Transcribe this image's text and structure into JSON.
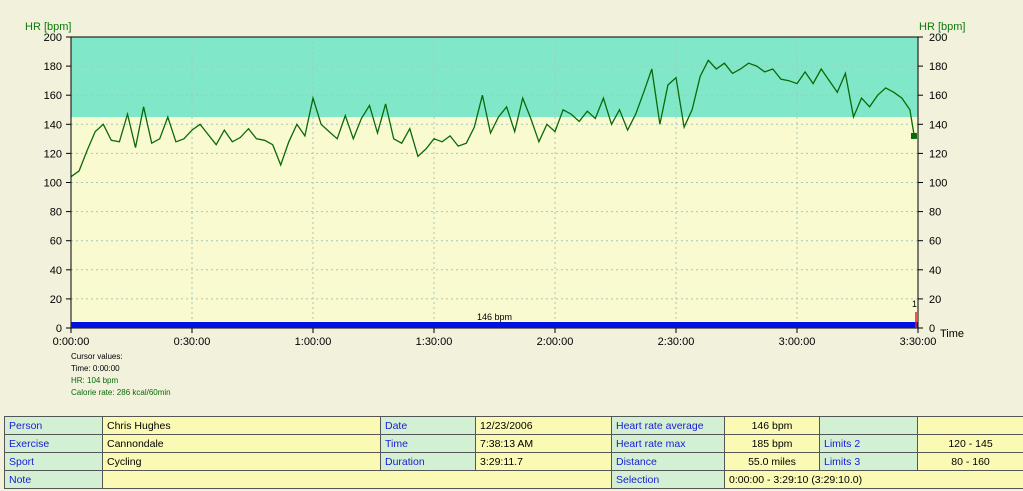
{
  "chart_data": {
    "type": "line",
    "ylabel_left": "HR [bpm]",
    "ylabel_right": "HR [bpm]",
    "xlabel": "Time",
    "ylim": [
      0,
      200
    ],
    "yticks": [
      "0",
      "20",
      "40",
      "60",
      "80",
      "100",
      "120",
      "140",
      "160",
      "180",
      "200"
    ],
    "xlim_minutes": [
      0,
      210
    ],
    "xticks": [
      "0:00:00",
      "0:30:00",
      "1:00:00",
      "1:30:00",
      "2:00:00",
      "2:30:00",
      "3:00:00",
      "3:30:00"
    ],
    "grid": true,
    "upper_zone_from_bpm": 145,
    "colors": {
      "upper_zone": "#80e8c8",
      "lower_zone": "#fafad0",
      "line": "#0a6a0a",
      "average_bar": "#0010e0",
      "marker": "#e02020"
    },
    "series": [
      {
        "name": "HR",
        "x_minutes": [
          0,
          2,
          4,
          6,
          8,
          10,
          12,
          14,
          16,
          18,
          20,
          22,
          24,
          26,
          28,
          30,
          32,
          34,
          36,
          38,
          40,
          42,
          44,
          46,
          48,
          50,
          52,
          54,
          56,
          58,
          60,
          62,
          64,
          66,
          68,
          70,
          72,
          74,
          76,
          78,
          80,
          82,
          84,
          86,
          88,
          90,
          92,
          94,
          96,
          98,
          100,
          102,
          104,
          106,
          108,
          110,
          112,
          114,
          116,
          118,
          120,
          122,
          124,
          126,
          128,
          130,
          132,
          134,
          136,
          138,
          140,
          142,
          144,
          146,
          148,
          150,
          152,
          154,
          156,
          158,
          160,
          162,
          164,
          166,
          168,
          170,
          172,
          174,
          176,
          178,
          180,
          182,
          184,
          186,
          188,
          190,
          192,
          194,
          196,
          198,
          200,
          202,
          204,
          206,
          208,
          209
        ],
        "values_bpm": [
          104,
          108,
          122,
          135,
          140,
          129,
          128,
          147,
          124,
          152,
          127,
          130,
          145,
          128,
          130,
          136,
          140,
          133,
          126,
          136,
          128,
          131,
          137,
          130,
          129,
          126,
          112,
          128,
          140,
          132,
          158,
          140,
          135,
          130,
          146,
          130,
          144,
          153,
          134,
          154,
          130,
          127,
          137,
          118,
          123,
          130,
          128,
          132,
          125,
          127,
          138,
          160,
          134,
          145,
          152,
          135,
          158,
          144,
          128,
          140,
          135,
          150,
          147,
          142,
          149,
          144,
          158,
          140,
          150,
          136,
          147,
          162,
          178,
          140,
          167,
          172,
          138,
          150,
          173,
          184,
          178,
          182,
          175,
          178,
          182,
          180,
          176,
          178,
          171,
          170,
          168,
          176,
          168,
          178,
          170,
          162,
          175,
          145,
          158,
          152,
          160,
          165,
          162,
          158,
          150,
          133
        ],
        "last_point_bpm": 132
      }
    ],
    "average": {
      "label": "146 bpm",
      "value": 146
    },
    "marker_label": "1"
  },
  "cursor": {
    "title": "Cursor values:",
    "time": "Time: 0:00:00",
    "hr": "HR: 104 bpm",
    "calorie": "Calorie rate: 286 kcal/60min"
  },
  "info": {
    "person_label": "Person",
    "person": "Chris Hughes",
    "exercise_label": "Exercise",
    "exercise": "Cannondale",
    "sport_label": "Sport",
    "sport": "Cycling",
    "note_label": "Note",
    "note": "",
    "date_label": "Date",
    "date": "12/23/2006",
    "time_label": "Time",
    "time": "7:38:13 AM",
    "duration_label": "Duration",
    "duration": "3:29:11.7",
    "hr_avg_label": "Heart rate average",
    "hr_avg": "146 bpm",
    "hr_max_label": "Heart rate max",
    "hr_max": "185 bpm",
    "distance_label": "Distance",
    "distance": "55.0 miles",
    "selection_label": "Selection",
    "selection": "0:00:00 - 3:29:10 (3:29:10.0)",
    "limits2_label": "Limits 2",
    "limits2": "120 - 145",
    "limits3_label": "Limits 3",
    "limits3": "80 - 160"
  }
}
